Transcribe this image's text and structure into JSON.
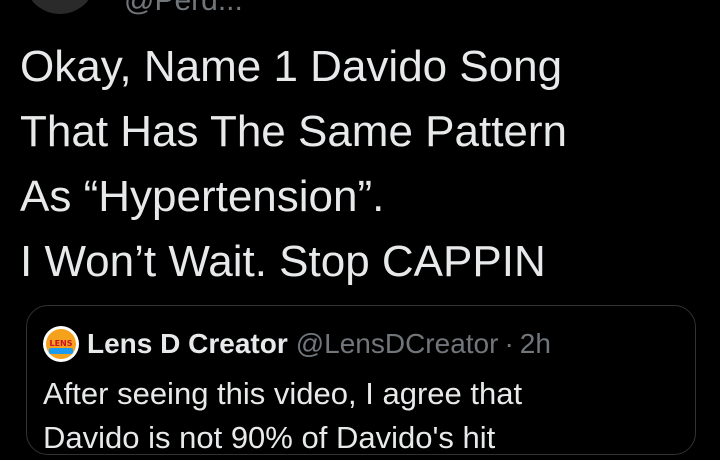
{
  "tweet": {
    "handle": "@Perd...",
    "text_lines": [
      "Okay, Name 1 Davido Song",
      "That Has The Same Pattern",
      "As “Hypertension”.",
      "I Won’t Wait. Stop CAPPIN"
    ]
  },
  "quoted_tweet": {
    "avatar_icon": "lens-d-creator-logo-icon",
    "avatar_text": "LENS",
    "author_name": "Lens D Creator",
    "author_handle": "@LensDCreator",
    "separator": "·",
    "time": "2h",
    "text_lines": [
      "After seeing this video, I agree that",
      "Davido is not 90% of Davido's hit"
    ]
  },
  "colors": {
    "background": "#000000",
    "primary_text": "#e7e9ea",
    "secondary_text": "#71767b",
    "border": "#2f3336"
  }
}
